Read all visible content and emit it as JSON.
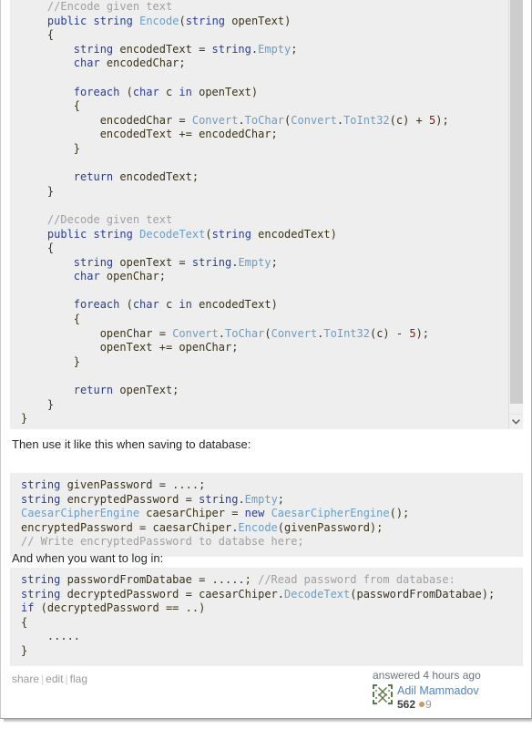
{
  "post": {
    "code_block_main": [
      {
        "indent": 4,
        "tokens": [
          {
            "t": "//Encode given text",
            "c": "c-com"
          }
        ]
      },
      {
        "indent": 4,
        "tokens": [
          {
            "t": "public",
            "c": "c-kw"
          },
          {
            "t": " ",
            "c": "c-pln"
          },
          {
            "t": "string",
            "c": "c-kw"
          },
          {
            "t": " ",
            "c": "c-pln"
          },
          {
            "t": "Encode",
            "c": "c-type"
          },
          {
            "t": "(",
            "c": "c-pln"
          },
          {
            "t": "string",
            "c": "c-kw"
          },
          {
            "t": " openText)",
            "c": "c-pln"
          }
        ]
      },
      {
        "indent": 4,
        "tokens": [
          {
            "t": "{",
            "c": "c-pln"
          }
        ]
      },
      {
        "indent": 8,
        "tokens": [
          {
            "t": "string",
            "c": "c-kw"
          },
          {
            "t": " encodedText = ",
            "c": "c-pln"
          },
          {
            "t": "string",
            "c": "c-kw"
          },
          {
            "t": ".",
            "c": "c-pln"
          },
          {
            "t": "Empty",
            "c": "c-type"
          },
          {
            "t": ";",
            "c": "c-pln"
          }
        ]
      },
      {
        "indent": 8,
        "tokens": [
          {
            "t": "char",
            "c": "c-kw"
          },
          {
            "t": " encodedChar;",
            "c": "c-pln"
          }
        ]
      },
      {
        "indent": 0,
        "tokens": []
      },
      {
        "indent": 8,
        "tokens": [
          {
            "t": "foreach",
            "c": "c-kw"
          },
          {
            "t": " (",
            "c": "c-pln"
          },
          {
            "t": "char",
            "c": "c-kw"
          },
          {
            "t": " c ",
            "c": "c-pln"
          },
          {
            "t": "in",
            "c": "c-kw"
          },
          {
            "t": " openText)",
            "c": "c-pln"
          }
        ]
      },
      {
        "indent": 8,
        "tokens": [
          {
            "t": "{",
            "c": "c-pln"
          }
        ]
      },
      {
        "indent": 12,
        "tokens": [
          {
            "t": "encodedChar = ",
            "c": "c-pln"
          },
          {
            "t": "Convert",
            "c": "c-type"
          },
          {
            "t": ".",
            "c": "c-pln"
          },
          {
            "t": "ToChar",
            "c": "c-type"
          },
          {
            "t": "(",
            "c": "c-pln"
          },
          {
            "t": "Convert",
            "c": "c-type"
          },
          {
            "t": ".",
            "c": "c-pln"
          },
          {
            "t": "ToInt32",
            "c": "c-type"
          },
          {
            "t": "(c) + ",
            "c": "c-pln"
          },
          {
            "t": "5",
            "c": "c-num"
          },
          {
            "t": ");",
            "c": "c-pln"
          }
        ]
      },
      {
        "indent": 12,
        "tokens": [
          {
            "t": "encodedText += encodedChar;",
            "c": "c-pln"
          }
        ]
      },
      {
        "indent": 8,
        "tokens": [
          {
            "t": "}",
            "c": "c-pln"
          }
        ]
      },
      {
        "indent": 0,
        "tokens": []
      },
      {
        "indent": 8,
        "tokens": [
          {
            "t": "return",
            "c": "c-kw"
          },
          {
            "t": " encodedText;",
            "c": "c-pln"
          }
        ]
      },
      {
        "indent": 4,
        "tokens": [
          {
            "t": "}",
            "c": "c-pln"
          }
        ]
      },
      {
        "indent": 0,
        "tokens": []
      },
      {
        "indent": 4,
        "tokens": [
          {
            "t": "//Decode given text",
            "c": "c-com"
          }
        ]
      },
      {
        "indent": 4,
        "tokens": [
          {
            "t": "public",
            "c": "c-kw"
          },
          {
            "t": " ",
            "c": "c-pln"
          },
          {
            "t": "string",
            "c": "c-kw"
          },
          {
            "t": " ",
            "c": "c-pln"
          },
          {
            "t": "DecodeText",
            "c": "c-type"
          },
          {
            "t": "(",
            "c": "c-pln"
          },
          {
            "t": "string",
            "c": "c-kw"
          },
          {
            "t": " encodedText)",
            "c": "c-pln"
          }
        ]
      },
      {
        "indent": 4,
        "tokens": [
          {
            "t": "{",
            "c": "c-pln"
          }
        ]
      },
      {
        "indent": 8,
        "tokens": [
          {
            "t": "string",
            "c": "c-kw"
          },
          {
            "t": " openText = ",
            "c": "c-pln"
          },
          {
            "t": "string",
            "c": "c-kw"
          },
          {
            "t": ".",
            "c": "c-pln"
          },
          {
            "t": "Empty",
            "c": "c-type"
          },
          {
            "t": ";",
            "c": "c-pln"
          }
        ]
      },
      {
        "indent": 8,
        "tokens": [
          {
            "t": "char",
            "c": "c-kw"
          },
          {
            "t": " openChar;",
            "c": "c-pln"
          }
        ]
      },
      {
        "indent": 0,
        "tokens": []
      },
      {
        "indent": 8,
        "tokens": [
          {
            "t": "foreach",
            "c": "c-kw"
          },
          {
            "t": " (",
            "c": "c-pln"
          },
          {
            "t": "char",
            "c": "c-kw"
          },
          {
            "t": " c ",
            "c": "c-pln"
          },
          {
            "t": "in",
            "c": "c-kw"
          },
          {
            "t": " encodedText)",
            "c": "c-pln"
          }
        ]
      },
      {
        "indent": 8,
        "tokens": [
          {
            "t": "{",
            "c": "c-pln"
          }
        ]
      },
      {
        "indent": 12,
        "tokens": [
          {
            "t": "openChar = ",
            "c": "c-pln"
          },
          {
            "t": "Convert",
            "c": "c-type"
          },
          {
            "t": ".",
            "c": "c-pln"
          },
          {
            "t": "ToChar",
            "c": "c-type"
          },
          {
            "t": "(",
            "c": "c-pln"
          },
          {
            "t": "Convert",
            "c": "c-type"
          },
          {
            "t": ".",
            "c": "c-pln"
          },
          {
            "t": "ToInt32",
            "c": "c-type"
          },
          {
            "t": "(c) - ",
            "c": "c-pln"
          },
          {
            "t": "5",
            "c": "c-num"
          },
          {
            "t": ");",
            "c": "c-pln"
          }
        ]
      },
      {
        "indent": 12,
        "tokens": [
          {
            "t": "openText += openChar;",
            "c": "c-pln"
          }
        ]
      },
      {
        "indent": 8,
        "tokens": [
          {
            "t": "}",
            "c": "c-pln"
          }
        ]
      },
      {
        "indent": 0,
        "tokens": []
      },
      {
        "indent": 8,
        "tokens": [
          {
            "t": "return",
            "c": "c-kw"
          },
          {
            "t": " openText;",
            "c": "c-pln"
          }
        ]
      },
      {
        "indent": 4,
        "tokens": [
          {
            "t": "}",
            "c": "c-pln"
          }
        ]
      },
      {
        "indent": 0,
        "tokens": [
          {
            "t": "}",
            "c": "c-pln"
          }
        ]
      }
    ],
    "paragraph_1": "Then use it like this when saving to database:",
    "code_block_save": [
      {
        "indent": 0,
        "tokens": [
          {
            "t": "string",
            "c": "c-kw"
          },
          {
            "t": " givenPassword = ....;",
            "c": "c-pln"
          }
        ]
      },
      {
        "indent": 0,
        "tokens": [
          {
            "t": "string",
            "c": "c-kw"
          },
          {
            "t": " encryptedPassword = ",
            "c": "c-pln"
          },
          {
            "t": "string",
            "c": "c-kw"
          },
          {
            "t": ".",
            "c": "c-pln"
          },
          {
            "t": "Empty",
            "c": "c-type"
          },
          {
            "t": ";",
            "c": "c-pln"
          }
        ]
      },
      {
        "indent": 0,
        "tokens": [
          {
            "t": "CaesarCipherEngine",
            "c": "c-type"
          },
          {
            "t": " caesarChiper = ",
            "c": "c-pln"
          },
          {
            "t": "new",
            "c": "c-kw"
          },
          {
            "t": " ",
            "c": "c-pln"
          },
          {
            "t": "CaesarCipherEngine",
            "c": "c-type"
          },
          {
            "t": "();",
            "c": "c-pln"
          }
        ]
      },
      {
        "indent": 0,
        "tokens": [
          {
            "t": "encryptedPassword = caesarChiper.",
            "c": "c-pln"
          },
          {
            "t": "Encode",
            "c": "c-type"
          },
          {
            "t": "(givenPassword);",
            "c": "c-pln"
          }
        ]
      },
      {
        "indent": 0,
        "tokens": [
          {
            "t": "// Write encryptedPassword to databse here;",
            "c": "c-com"
          }
        ]
      }
    ],
    "paragraph_2": "And when you want to log in:",
    "code_block_login": [
      {
        "indent": 0,
        "tokens": [
          {
            "t": "string",
            "c": "c-kw"
          },
          {
            "t": " passwordFromDatabae = .....; ",
            "c": "c-pln"
          },
          {
            "t": "//Read password from database:",
            "c": "c-com"
          }
        ]
      },
      {
        "indent": 0,
        "tokens": [
          {
            "t": "string",
            "c": "c-kw"
          },
          {
            "t": " decryptedPassword = caesarChiper.",
            "c": "c-pln"
          },
          {
            "t": "DecodeText",
            "c": "c-type"
          },
          {
            "t": "(passwordFromDatabae);",
            "c": "c-pln"
          }
        ]
      },
      {
        "indent": 0,
        "tokens": [
          {
            "t": "if",
            "c": "c-kw"
          },
          {
            "t": " (decryptedPassword == ..)",
            "c": "c-pln"
          }
        ]
      },
      {
        "indent": 0,
        "tokens": [
          {
            "t": "{",
            "c": "c-pln"
          }
        ]
      },
      {
        "indent": 4,
        "tokens": [
          {
            "t": ".....",
            "c": "c-pln"
          }
        ]
      },
      {
        "indent": 0,
        "tokens": [
          {
            "t": "}",
            "c": "c-pln"
          }
        ]
      }
    ]
  },
  "footer": {
    "share_label": "share",
    "edit_label": "edit",
    "flag_label": "flag",
    "separator": "|",
    "action_time": "answered 4 hours ago",
    "user_name": "Adil Mammadov",
    "reputation": "562",
    "bronze_badge_count": "9"
  },
  "colors": {
    "code_background": "#eeeeee",
    "keyword": "#2b3d8f",
    "type": "#6a9ec5",
    "comment": "#a0a0a0",
    "number": "#7a2518",
    "link": "#4a86c7",
    "muted": "#9a9a9a",
    "bronze_badge": "#cc9966"
  }
}
